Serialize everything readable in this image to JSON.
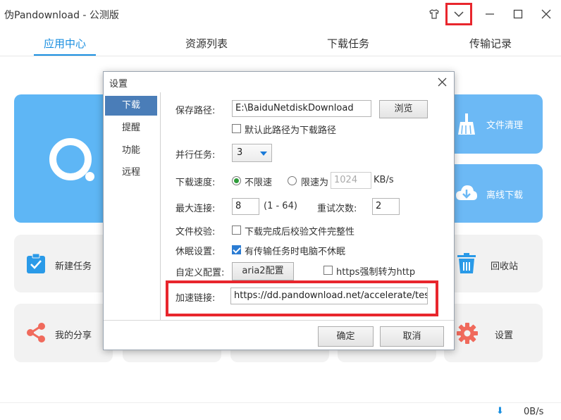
{
  "window": {
    "title": "伪Pandownload - 公测版",
    "icons": [
      "skin-icon",
      "chevron-down-icon",
      "minimize-icon",
      "maximize-icon",
      "close-icon"
    ]
  },
  "nav": {
    "tabs": [
      {
        "label": "应用中心",
        "active": true
      },
      {
        "label": "资源列表"
      },
      {
        "label": "下载任务"
      },
      {
        "label": "传输记录"
      }
    ]
  },
  "home": {
    "cards": {
      "clean": "文件清理",
      "offline": "离线下载",
      "new_task": "新建任务",
      "recycle": "回收站",
      "share": "我的分享",
      "settings": "设置"
    }
  },
  "status": {
    "speed": "0B/s"
  },
  "dialog": {
    "title": "设置",
    "sidebar": [
      "下载",
      "提醒",
      "功能",
      "远程"
    ],
    "save_path_label": "保存路径:",
    "save_path_value": "E:\\BaiduNetdiskDownload",
    "browse_button": "浏览",
    "default_path_checkbox": "默认此路径为下载路径",
    "parallel_label": "并行任务:",
    "parallel_value": "3",
    "speed_label": "下载速度:",
    "speed_unlimited": "不限速",
    "speed_limited": "限速为",
    "speed_limit_value": "1024",
    "speed_unit": "KB/s",
    "max_conn_label": "最大连接:",
    "max_conn_value": "8",
    "max_conn_range": "(1 - 64)",
    "retry_label": "重试次数:",
    "retry_value": "2",
    "verify_label": "文件校验:",
    "verify_checkbox": "下载完成后校验文件完整性",
    "sleep_label": "休眠设置:",
    "sleep_checkbox": "有传输任务时电脑不休眠",
    "custom_label": "自定义配置:",
    "aria2_button": "aria2配置",
    "https_checkbox": "https强制转为http",
    "accel_label": "加速链接:",
    "accel_value": "https://dd.pandownload.net/accelerate/test",
    "ok_button": "确定",
    "cancel_button": "取消"
  },
  "colors": {
    "accent": "#1a8fe0",
    "highlight": "#e8262d",
    "card_blue": "#6cb9f5",
    "sidebar_active": "#4a7db8"
  }
}
